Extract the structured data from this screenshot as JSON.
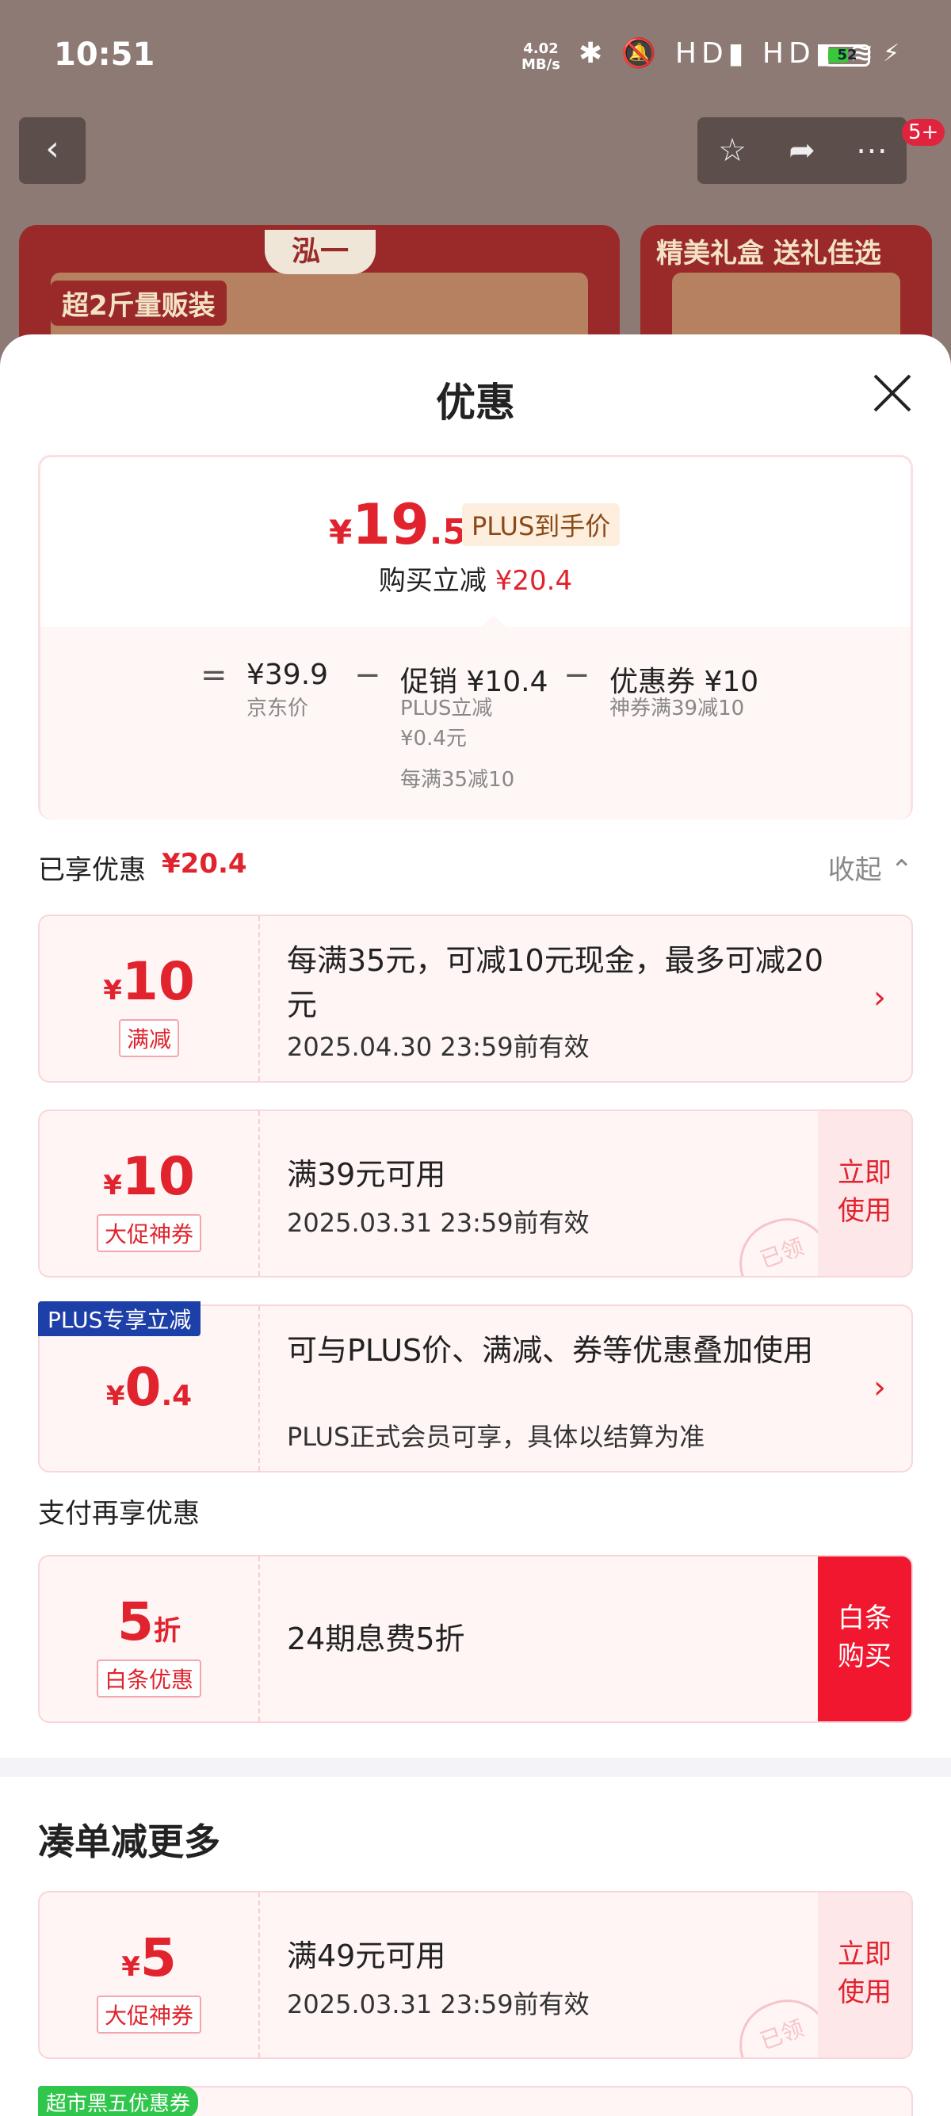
{
  "status_bar": {
    "time": "10:51",
    "net_speed_value": "4.02",
    "net_speed_unit": "MB/s",
    "icons": "✱ 🔕 HD▮ HD▮ ≋",
    "battery": "52",
    "battery_level": 0.52
  },
  "background": {
    "card1_brand": "泓一",
    "card1_tag": "超2斤量贩装",
    "card2_tag": "精美礼盒 送礼佳选",
    "msg_badge": "5+"
  },
  "sheet": {
    "title": "优惠",
    "summary": {
      "price_symbol": "¥",
      "price_int": "19",
      "price_dec": ".5",
      "plus_tag": "PLUS到手价",
      "save_label": "购买立减",
      "save_value": "¥20.4",
      "eq": "=",
      "minus": "−",
      "jd_price": "¥39.9",
      "jd_price_label": "京东价",
      "promo": "促销 ¥10.4",
      "promo_sub1": "PLUS立减",
      "promo_sub2": "¥0.4元",
      "promo_sub3": "每满35减10",
      "coupon": "优惠券 ¥10",
      "coupon_sub": "神券满39减10"
    },
    "enjoyed": {
      "label": "已享优惠",
      "value": "¥20.4",
      "collapse": "收起"
    },
    "coupons": [
      {
        "yen": "¥",
        "amount": "10",
        "tag": "满减",
        "main": "每满35元，可减10元现金，最多可减20元",
        "sub": "2025.04.30 23:59前有效"
      },
      {
        "yen": "¥",
        "amount": "10",
        "tag": "大促神券",
        "main": "满39元可用",
        "sub": "2025.03.31 23:59前有效",
        "action1": "立即",
        "action2": "使用",
        "stamp": "已领"
      },
      {
        "label": "PLUS专享立减",
        "yen": "¥",
        "amount": "0",
        "amount_dec": ".4",
        "main": "可与PLUS价、满减、券等优惠叠加使用",
        "sub": "PLUS正式会员可享，具体以结算为准"
      }
    ],
    "pay_title": "支付再享优惠",
    "pay_coupon": {
      "amount": "5",
      "unit": "折",
      "tag": "白条优惠",
      "main": "24期息费5折",
      "action1": "白条",
      "action2": "购买"
    },
    "more_title": "凑单减更多",
    "more_coupon": {
      "yen": "¥",
      "amount": "5",
      "tag": "大促神券",
      "main": "满49元可用",
      "sub": "2025.03.31 23:59前有效",
      "action1": "立即",
      "action2": "使用",
      "stamp": "已领"
    },
    "black_label": "超市黑五优惠券",
    "arrow": "›"
  }
}
